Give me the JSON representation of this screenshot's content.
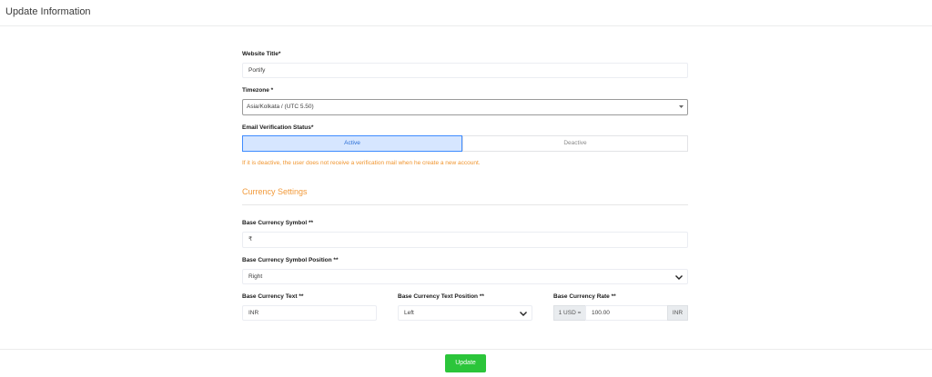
{
  "header": {
    "title": "Update Information"
  },
  "form": {
    "website_title": {
      "label": "Website Title*",
      "value": "Portify"
    },
    "timezone": {
      "label": "Timezone *",
      "value": "Asia/Kolkata / (UTC 5.50)"
    },
    "email_verification": {
      "label": "Email Verification Status*",
      "options": [
        "Active",
        "Deactive"
      ],
      "selected": "Active",
      "hint": "If it is deactive, the user does not receive a verification mail when he create a new account."
    }
  },
  "currency": {
    "section_title": "Currency Settings",
    "symbol": {
      "label": "Base Currency Symbol **",
      "value": "₹"
    },
    "symbol_position": {
      "label": "Base Currency Symbol Position **",
      "value": "Right"
    },
    "text": {
      "label": "Base Currency Text **",
      "value": "INR"
    },
    "text_position": {
      "label": "Base Currency Text Position **",
      "value": "Left"
    },
    "rate": {
      "label": "Base Currency Rate **",
      "prefix": "1 USD =",
      "value": "100.00",
      "suffix": "INR"
    }
  },
  "footer": {
    "update_label": "Update"
  },
  "colors": {
    "accent_orange": "#f29a3a",
    "active_blue": "#3e8bff",
    "update_green": "#2bc53a"
  },
  "icons": {
    "select_arrow": "chevron-down-icon"
  }
}
